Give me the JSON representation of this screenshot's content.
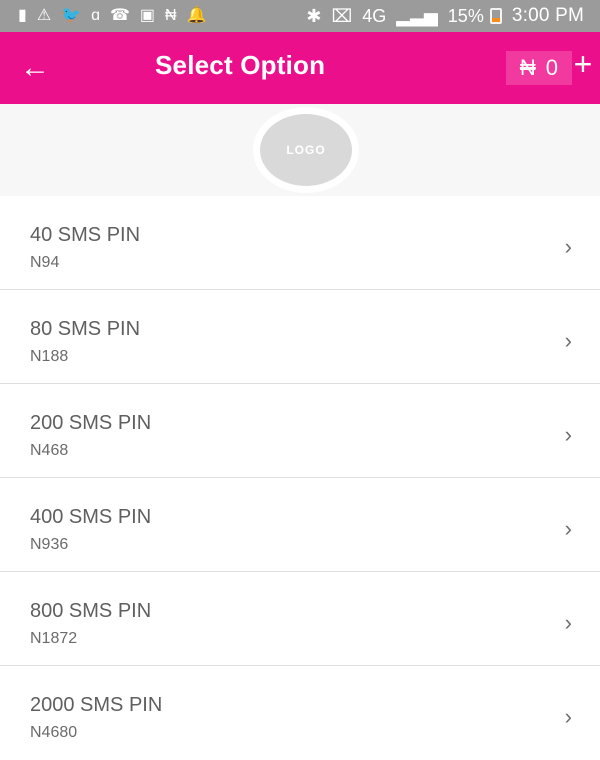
{
  "status_bar": {
    "battery_percent": "15%",
    "time": "3:00 PM",
    "left_icons": [
      "battery-icon",
      "warning-icon",
      "twitter-icon",
      "chat-icon",
      "phone-icon",
      "image-icon",
      "naira-icon",
      "notification-icon"
    ],
    "right_icons": [
      "bluetooth-icon",
      "nfc-icon",
      "4g-icon",
      "signal-icon",
      "battery-icon"
    ]
  },
  "app_bar": {
    "back_icon": "arrow-left-icon",
    "title": "Select Option",
    "balance_currency": "₦",
    "balance_value": "0",
    "plus_icon": "plus-icon",
    "color": "#ec0f8c"
  },
  "logo": {
    "label": "LOGO"
  },
  "options": [
    {
      "title": "40 SMS PIN",
      "price": "N94"
    },
    {
      "title": "80 SMS PIN",
      "price": "N188"
    },
    {
      "title": "200 SMS PIN",
      "price": "N468"
    },
    {
      "title": "400 SMS PIN",
      "price": "N936"
    },
    {
      "title": "800 SMS PIN",
      "price": "N1872"
    },
    {
      "title": "2000 SMS PIN",
      "price": "N4680"
    }
  ]
}
